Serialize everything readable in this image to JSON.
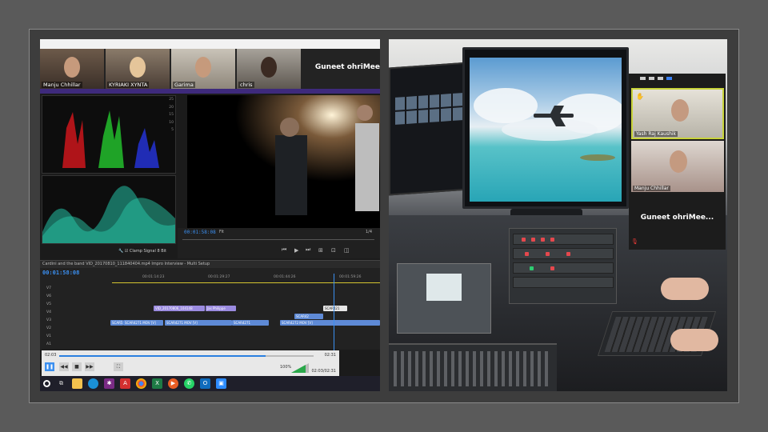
{
  "left": {
    "gallery": [
      {
        "name": "Manju Chhillar"
      },
      {
        "name": "KYRIAKI XYNTA"
      },
      {
        "name": "Garima"
      },
      {
        "name": "chris"
      }
    ],
    "host_name": "Guneet ohriMee",
    "program_monitor": {
      "timecode": "00:01:58:08",
      "fit": "Fit",
      "fraction": "1/4"
    },
    "scope_ticks": [
      "25",
      "20",
      "15",
      "10",
      "5"
    ],
    "timeline": {
      "tabs": "Cardini and the band    VID_20170810_111840404.mp4 Impro Interview - Multi Setup",
      "timecode": "00:01:58:08",
      "ruler": [
        "00:01:14:23",
        "00:01:29:27",
        "00:01:44:26",
        "00:01:59:26"
      ],
      "tracks": [
        "V7",
        "V6",
        "V5",
        "V4",
        "V3",
        "V2",
        "V1",
        "A1",
        "Audio 7"
      ],
      "clips": [
        {
          "label": "VID_20170806_104148",
          "kind": "v"
        },
        {
          "label": "Jas Philippe",
          "kind": "v"
        },
        {
          "label": "SCAR421",
          "kind": "w"
        },
        {
          "label": "SCAR42",
          "kind": "a"
        },
        {
          "label": "SCAR5",
          "kind": "a"
        },
        {
          "label": "SCAR4271 MOV [V]",
          "kind": "a"
        },
        {
          "label": "SCAR4271 MOV [V]",
          "kind": "a"
        },
        {
          "label": "SCAR4271",
          "kind": "a"
        },
        {
          "label": "SCAR4272 MOV [V]",
          "kind": "a"
        }
      ],
      "clamp_signal": "Clamp Signal",
      "bit": "8 Bit"
    },
    "player": {
      "elapsed": "02:03",
      "total": "02:31",
      "progress_fraction": 0.81,
      "volume": "100%",
      "timecode": "02:03/02:31"
    }
  },
  "right": {
    "zoom_tiles": [
      {
        "name": "Yash Raj Kaushik"
      },
      {
        "name": "Manju Chhillar"
      }
    ],
    "host_name": "Guneet  ohriMee..."
  },
  "icons": [
    "start-circle-icon",
    "task-view-icon",
    "file-explorer-icon",
    "edge-icon",
    "slack-icon",
    "acrobat-icon",
    "chrome-icon",
    "excel-icon",
    "media-player-icon",
    "whatsapp-icon",
    "outlook-icon",
    "zoom-icon"
  ]
}
